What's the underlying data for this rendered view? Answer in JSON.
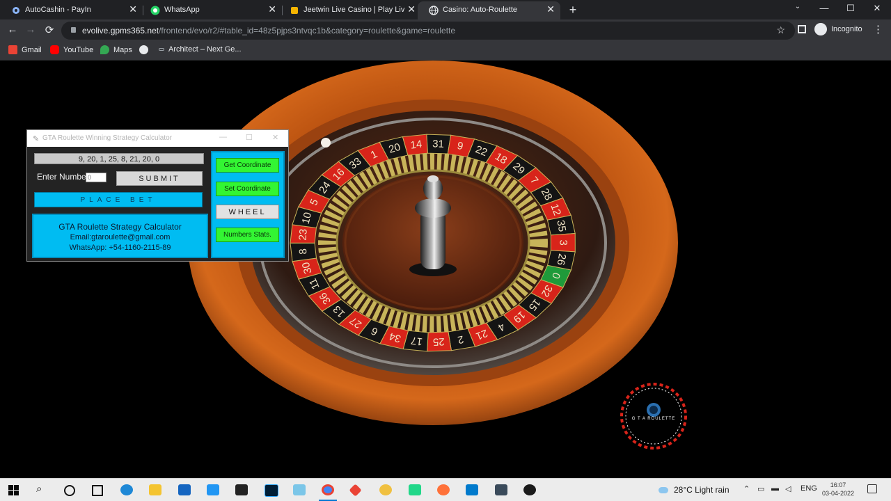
{
  "tabs": [
    {
      "label": "AutoCashin - PayIn",
      "active": false
    },
    {
      "label": "WhatsApp",
      "active": false
    },
    {
      "label": "Jeetwin Live Casino | Play Live Ro",
      "active": false
    },
    {
      "label": "Casino: Auto-Roulette",
      "active": true
    }
  ],
  "window_controls": {
    "minimize": "—",
    "maximize": "☐",
    "close": "✕"
  },
  "toolbar": {
    "back": "←",
    "forward": "→",
    "reload": "⟳",
    "url_host": "evolive.gpms365.net",
    "url_path": "/frontend/evo/r2/#table_id=48z5pjps3ntvqc1b&category=roulette&game=roulette",
    "incognito_label": "Incognito",
    "menu": "⋮"
  },
  "bookmarks": [
    {
      "label": "Gmail",
      "color": "#ea4335"
    },
    {
      "label": "YouTube",
      "color": "#ff0000"
    },
    {
      "label": "Maps",
      "color": "#34a853"
    },
    {
      "label": "",
      "color": "#e8eaed"
    },
    {
      "label": "Architect – Next Ge...",
      "color": "#9aa0a6"
    }
  ],
  "roulette": {
    "wheel_numbers": [
      "0",
      "32",
      "15",
      "19",
      "4",
      "21",
      "2",
      "25",
      "17",
      "34",
      "6",
      "27",
      "13",
      "36",
      "11",
      "30",
      "8",
      "23",
      "10",
      "5",
      "24",
      "16",
      "33",
      "1",
      "20",
      "14",
      "31",
      "9",
      "22",
      "18",
      "29",
      "7",
      "28",
      "12",
      "35",
      "3",
      "26"
    ],
    "colors": {
      "red": "#d8241a",
      "black": "#141414",
      "green": "#1f9a3a",
      "wood": "#c65a12",
      "gold": "#c8b45a"
    }
  },
  "calculator": {
    "title": "GTA Roulette Winning Strategy Calculator",
    "results": "9, 20, 1, 25, 8, 21, 20, 0",
    "enter_label": "Enter Number",
    "input_value": "0",
    "submit": "SUBMIT",
    "place_bet": "PLACE BET",
    "info_title": "GTA Roulette Strategy Calculator",
    "info_email": "Email:gtaroulette@gmail.com",
    "info_whatsapp": "WhatsApp: +54-1160-2115-89",
    "btn_get_coordinate": "Get Coordinate",
    "btn_set_coordinate": "Set Coordinate",
    "btn_wheel": "WHEEL",
    "btn_numbers_stats": "Numbers Stats."
  },
  "logo": {
    "text": "G T A ROULETTE"
  },
  "taskbar": {
    "weather": "28°C  Light rain",
    "lang": "ENG",
    "time": "16:07",
    "date": "03-04-2022"
  }
}
